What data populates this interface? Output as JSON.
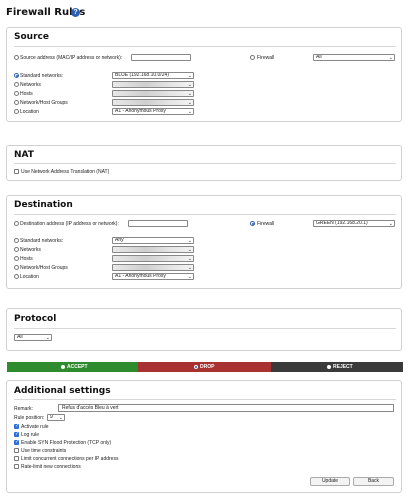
{
  "page": {
    "title": "Firewall Rules"
  },
  "source": {
    "heading": "Source",
    "source_address_label": "Source address (MAC/IP address or network):",
    "firewall_label": "Firewall",
    "firewall_select": "All",
    "standard_networks_label": "Standard networks:",
    "standard_networks_value": "BLUE (192.168.10.0/24)",
    "networks_label": "Networks",
    "hosts_label": "Hosts",
    "network_host_groups_label": "Network/Host Groups",
    "location_label": "Location",
    "location_value": "A1 - Anonymous Proxy"
  },
  "nat": {
    "heading": "NAT",
    "use_nat_label": "Use Network Address Translation (NAT)"
  },
  "destination": {
    "heading": "Destination",
    "destination_address_label": "Destination address (IP address or network):",
    "firewall_label": "Firewall",
    "firewall_select": "GREEN (192.168.20.1)",
    "standard_networks_label": "Standard networks:",
    "standard_networks_value": "Any",
    "networks_label": "Networks",
    "hosts_label": "Hosts",
    "network_host_groups_label": "Network/Host Groups",
    "location_label": "Location",
    "location_value": "A1 - Anonymous Proxy"
  },
  "protocol": {
    "heading": "Protocol",
    "value": "All"
  },
  "actions": {
    "accept": "ACCEPT",
    "drop": "DROP",
    "reject": "REJECT",
    "accept_color": "#2e8b2e",
    "drop_color": "#a83232",
    "reject_color": "#3a3a3a"
  },
  "additional": {
    "heading": "Additional settings",
    "remark_label": "Remark:",
    "remark_value": "Refus d'accès Bleu à vert",
    "rule_position_label": "Rule position:",
    "rule_position_value": "9",
    "activate_rule": "Activate rule",
    "log_rule": "Log rule",
    "syn_flood": "Enable SYN Flood Protection (TCP only)",
    "time_constraints": "Use time constraints",
    "limit_concurrent": "Limit concurrent connections per IP address",
    "rate_limit": "Rate-limit new connections"
  },
  "footer": {
    "update": "Update",
    "back": "Back"
  }
}
